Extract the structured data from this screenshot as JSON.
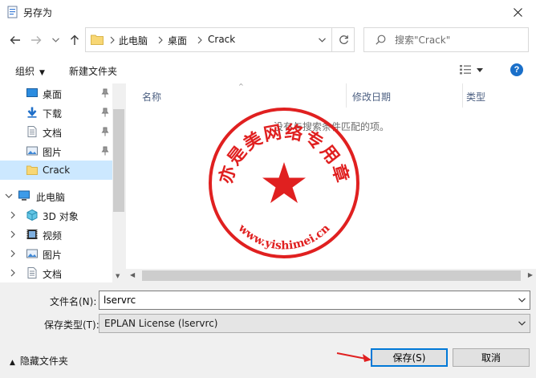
{
  "window": {
    "title": "另存为"
  },
  "address": {
    "crumbs": [
      "此电脑",
      "桌面",
      "Crack"
    ]
  },
  "search": {
    "placeholder": "搜索\"Crack\""
  },
  "toolbar": {
    "organize": "组织",
    "new_folder": "新建文件夹",
    "help": "?"
  },
  "sidebar": {
    "items": [
      {
        "label": "桌面",
        "icon": "desktop-icon",
        "pinned": true
      },
      {
        "label": "下载",
        "icon": "download-icon",
        "pinned": true
      },
      {
        "label": "文档",
        "icon": "document-icon",
        "pinned": true
      },
      {
        "label": "图片",
        "icon": "picture-icon",
        "pinned": true
      },
      {
        "label": "Crack",
        "icon": "folder-icon",
        "selected": true
      },
      {
        "label": "此电脑",
        "icon": "computer-icon",
        "expanded": true
      },
      {
        "label": "3D 对象",
        "icon": "3d-objects-icon"
      },
      {
        "label": "视频",
        "icon": "video-icon"
      },
      {
        "label": "图片",
        "icon": "picture-icon"
      },
      {
        "label": "文档",
        "icon": "document-icon"
      }
    ]
  },
  "columns": [
    "名称",
    "修改日期",
    "类型"
  ],
  "empty_message": "没有与搜索条件匹配的项。",
  "watermark": {
    "text": "亦是美网络专用章",
    "url": "www.yishimei.cn",
    "color": "#e02020"
  },
  "form": {
    "filename_label": "文件名(N):",
    "filename_value": "lservrc",
    "filetype_label": "保存类型(T):",
    "filetype_value": "EPLAN License (lservrc)"
  },
  "footer": {
    "hide_folders": "隐藏文件夹",
    "save": "保存(S)",
    "cancel": "取消"
  },
  "colors": {
    "accent": "#0078d7",
    "selection": "#cce8ff",
    "folder": "#f8d775",
    "stamp": "#e02020"
  }
}
